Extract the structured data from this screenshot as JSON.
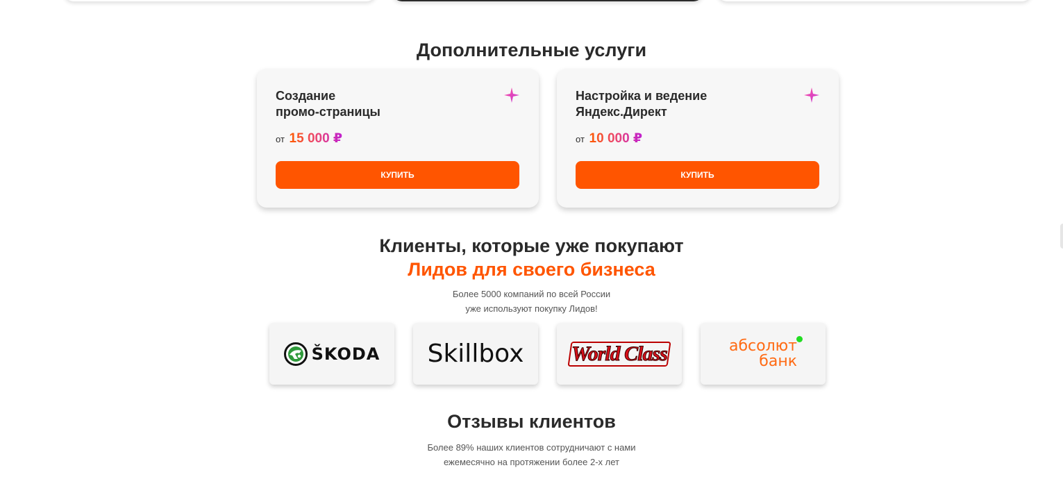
{
  "services": {
    "title": "Дополнительные услуги",
    "items": [
      {
        "title": "Создание\nпромо-страницы",
        "price_prefix": "от",
        "price": "15 000 ₽",
        "button": "КУПИТЬ"
      },
      {
        "title": "Настройка и ведение\nЯндекс.Директ",
        "price_prefix": "от",
        "price": "10 000 ₽",
        "button": "КУПИТЬ"
      }
    ]
  },
  "clients": {
    "title": "Клиенты, которые уже покупают",
    "title_accent": "Лидов для своего бизнеса",
    "subtitle_line1": "Более 5000 компаний по всей России",
    "subtitle_line2": "уже используют покупку Лидов!",
    "logos": [
      {
        "name": "ŠKODA",
        "icon": "skoda-logo-icon"
      },
      {
        "name": "Skillbox",
        "icon": "skillbox-logo"
      },
      {
        "name": "World Class",
        "icon": "world-class-logo"
      },
      {
        "name_line1": "абсолют",
        "name_line2": "банк",
        "icon": "absolut-bank-logo"
      }
    ]
  },
  "reviews": {
    "title": "Отзывы клиентов",
    "subtitle_line1": "Более 89% наших клиентов сотрудничают с нами",
    "subtitle_line2": "ежемесячно на протяжении более 2-х лет"
  },
  "colors": {
    "accent": "#ff5500",
    "text": "#2a2a2a",
    "absolut_orange": "#ff6a13",
    "absolut_dot": "#22dd22"
  }
}
